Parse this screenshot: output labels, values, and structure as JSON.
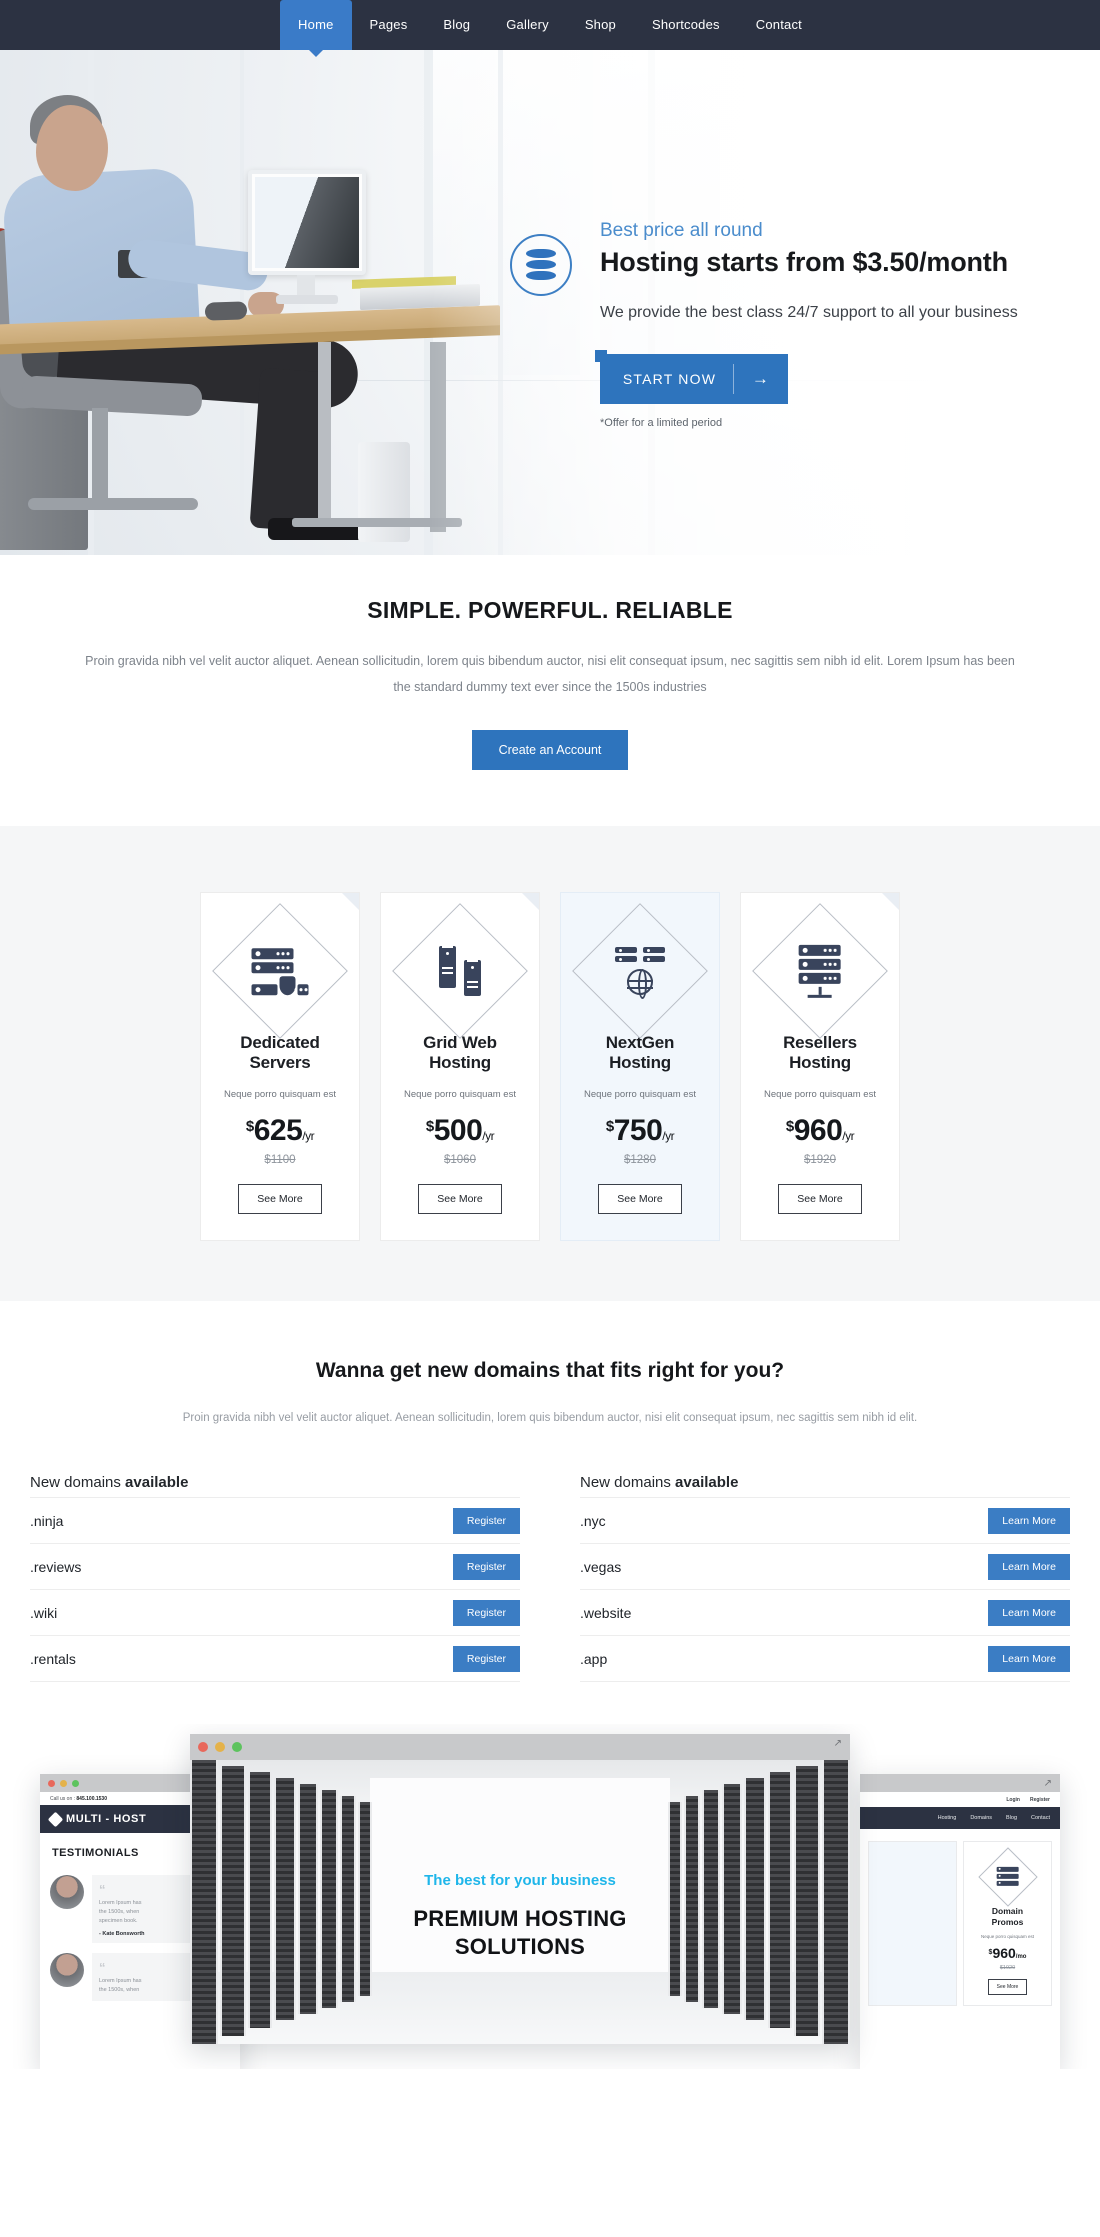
{
  "nav": {
    "items": [
      {
        "label": "Home",
        "active": true
      },
      {
        "label": "Pages",
        "active": false
      },
      {
        "label": "Blog",
        "active": false
      },
      {
        "label": "Gallery",
        "active": false
      },
      {
        "label": "Shop",
        "active": false
      },
      {
        "label": "Shortcodes",
        "active": false
      },
      {
        "label": "Contact",
        "active": false
      }
    ]
  },
  "hero": {
    "kicker": "Best price all round",
    "title": "Hosting starts from $3.50/month",
    "subtitle": "We provide the best class 24/7 support to all your business",
    "cta_label": "START NOW",
    "cta_arrow": "→",
    "offer_note": "*Offer for a limited period",
    "slider_dots": 3,
    "slider_prev_icon": "chevron-right-icon",
    "accent_color": "#2e74bd",
    "kicker_color": "#4a8ccc"
  },
  "intro": {
    "heading": "SIMPLE. POWERFUL. RELIABLE",
    "paragraph": "Proin gravida nibh vel velit auctor aliquet. Aenean sollicitudin, lorem quis bibendum auctor, nisi elit consequat ipsum, nec sagittis sem nibh id elit. Lorem Ipsum has been the  standard dummy text ever since the 1500s industries",
    "cta_label": "Create an Account"
  },
  "pricing": {
    "cards": [
      {
        "title": "Dedicated Servers",
        "icon": "server-shield-icon",
        "tagline": "Neque porro quisquam est",
        "currency": "$",
        "amount": "625",
        "period": "/yr",
        "old_price": "$1100",
        "button": "See More",
        "featured": false
      },
      {
        "title": "Grid Web Hosting",
        "icon": "grid-towers-icon",
        "tagline": "Neque porro quisquam est",
        "currency": "$",
        "amount": "500",
        "period": "/yr",
        "old_price": "$1060",
        "button": "See More",
        "featured": false
      },
      {
        "title": "NextGen Hosting",
        "icon": "server-globe-icon",
        "tagline": "Neque porro quisquam est",
        "currency": "$",
        "amount": "750",
        "period": "/yr",
        "old_price": "$1280",
        "button": "See More",
        "featured": true
      },
      {
        "title": "Resellers Hosting",
        "icon": "server-rack-icon",
        "tagline": "Neque porro quisquam est",
        "currency": "$",
        "amount": "960",
        "period": "/yr",
        "old_price": "$1920",
        "button": "See More",
        "featured": false
      }
    ]
  },
  "domains": {
    "heading": "Wanna get new domains that fits right for you?",
    "lead": "Proin gravida nibh vel velit auctor aliquet. Aenean sollicitudin, lorem quis bibendum auctor, nisi elit consequat ipsum, nec sagittis sem nibh id elit.",
    "columns": [
      {
        "title_plain": "New domains ",
        "title_bold": "available",
        "rows": [
          {
            "name": ".ninja",
            "button": "Register"
          },
          {
            "name": ".reviews",
            "button": "Register"
          },
          {
            "name": ".wiki",
            "button": "Register"
          },
          {
            "name": ".rentals",
            "button": "Register"
          }
        ]
      },
      {
        "title_plain": "New domains ",
        "title_bold": "available",
        "rows": [
          {
            "name": ".nyc",
            "button": "Learn More"
          },
          {
            "name": ".vegas",
            "button": "Learn More"
          },
          {
            "name": ".website",
            "button": "Learn More"
          },
          {
            "name": ".app",
            "button": "Learn More"
          }
        ]
      }
    ]
  },
  "showcase": {
    "center": {
      "kicker": "The best for your business",
      "title_line1": "PREMIUM HOSTING",
      "title_line2": "SOLUTIONS",
      "kicker_color": "#1fb6ea"
    },
    "left_mock": {
      "call_label": "Call us on :",
      "phone": "845.100.1530",
      "brand": "MULTI - HOST",
      "section_title": "TESTIMONIALS",
      "testimonials": [
        {
          "quote_line1": "Lorem Ipsum has",
          "quote_line2": "the 1500s, when",
          "quote_line3": "specimen book.",
          "author": "- Kate Bonsworth"
        },
        {
          "quote_line1": "Lorem Ipsum has",
          "quote_line2": "the 1500s, when",
          "quote_line3": "",
          "author": ""
        }
      ]
    },
    "right_mock": {
      "top_links": [
        "Login",
        "Register"
      ],
      "nav_items": [
        "Hosting",
        "Domains",
        "Blog",
        "Contact"
      ],
      "card": {
        "title_line1": "Domain",
        "title_line2": "Promos",
        "tagline": "Neque porro quisquam est",
        "currency": "$",
        "amount": "960",
        "period": "/mo",
        "old_price": "$1920",
        "button": "See More"
      }
    }
  }
}
